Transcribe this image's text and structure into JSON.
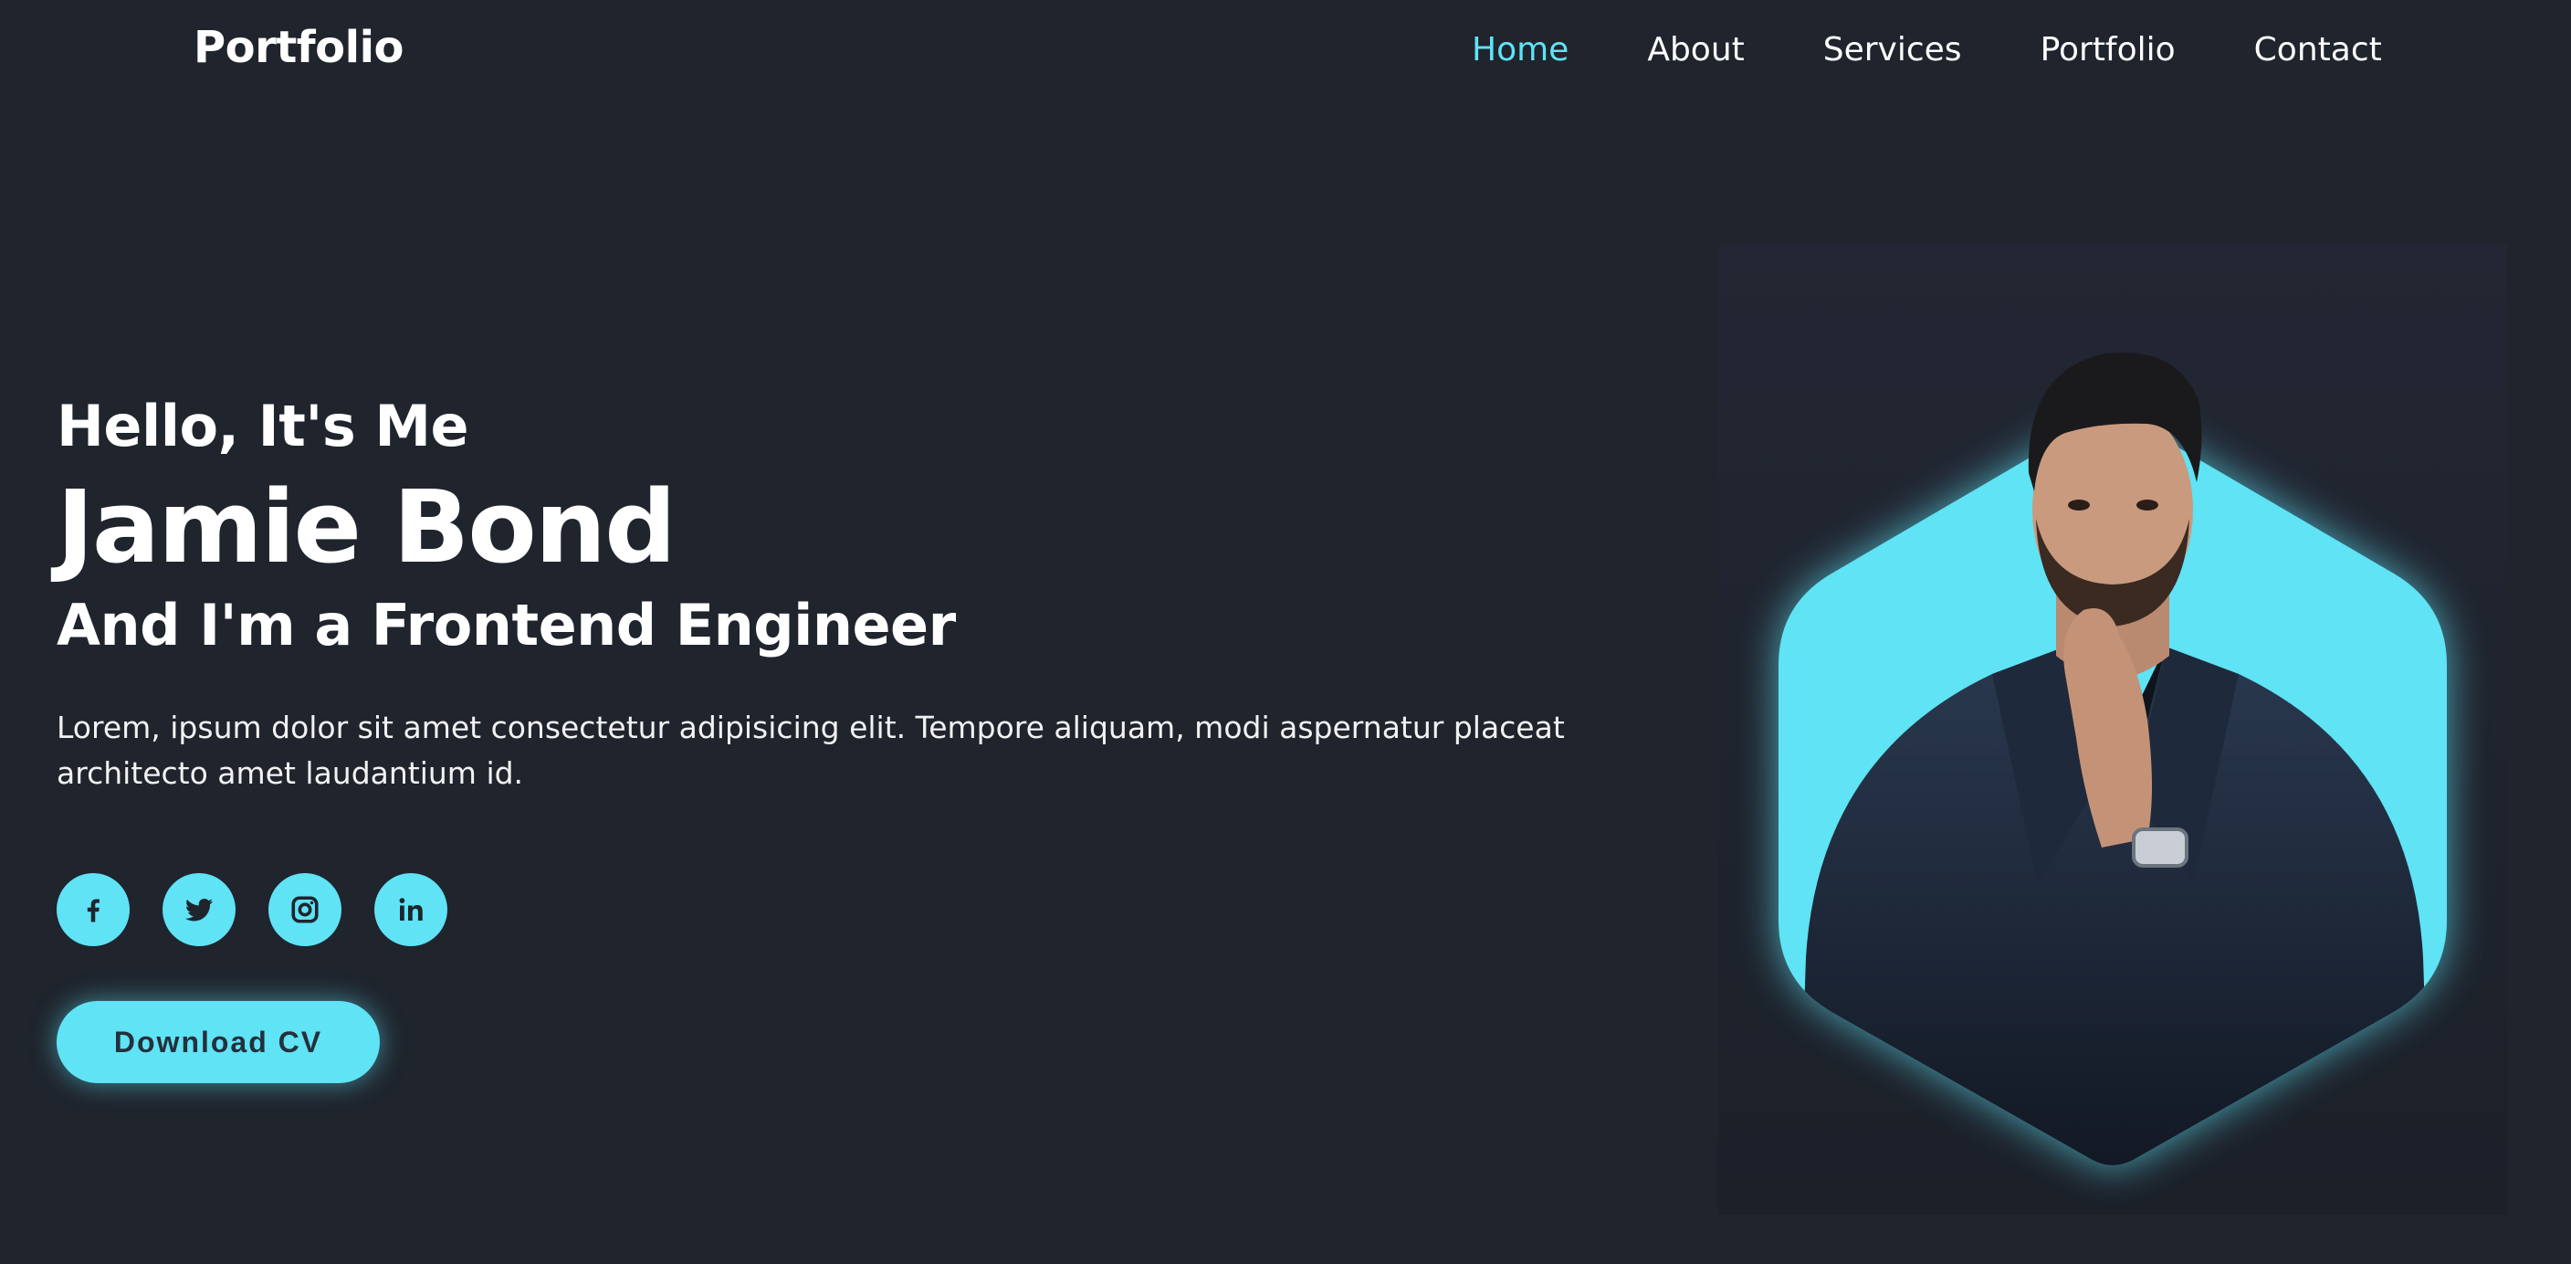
{
  "header": {
    "logo": "Portfolio",
    "nav": [
      "Home",
      "About",
      "Services",
      "Portfolio",
      "Contact"
    ],
    "active_nav": "Home"
  },
  "hero": {
    "greeting": "Hello, It's Me",
    "name": "Jamie Bond",
    "role": "And I'm a Frontend Engineer",
    "description": "Lorem, ipsum dolor sit amet consectetur adipisicing elit. Tempore aliquam, modi aspernatur placeat architecto amet laudantium id.",
    "socials": [
      "facebook-icon",
      "twitter-icon",
      "instagram-icon",
      "linkedin-icon"
    ],
    "cta": "Download CV"
  },
  "colors": {
    "background": "#1f242d",
    "accent": "#5fe3f5",
    "text": "#ffffff"
  }
}
